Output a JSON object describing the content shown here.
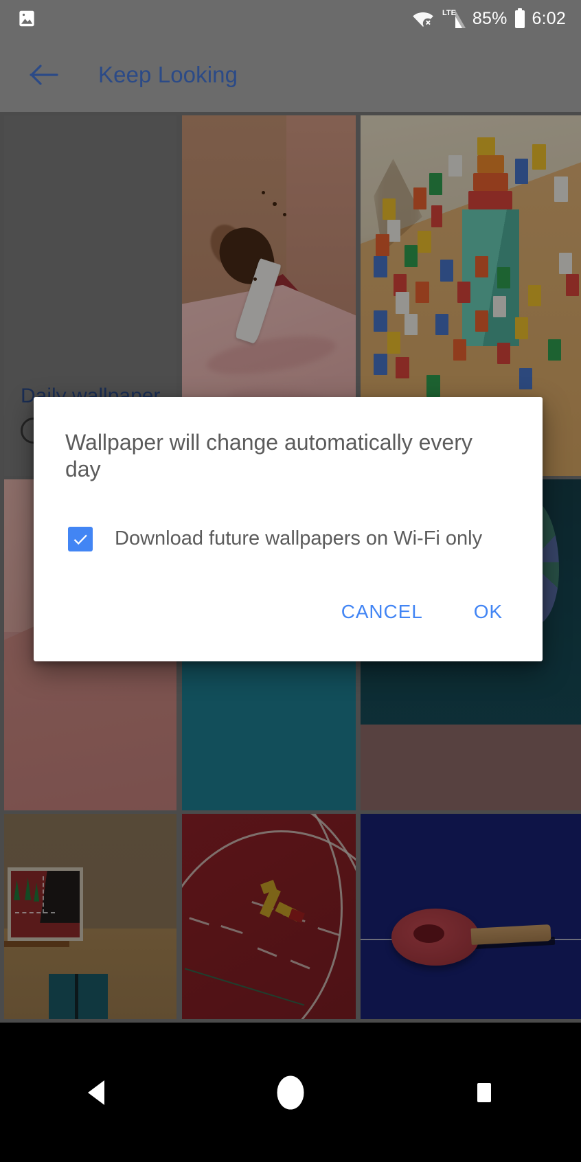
{
  "status_bar": {
    "notification_icon": "image-icon",
    "wifi_icon": "wifi-disconnected-icon",
    "network_type": "LTE",
    "signal_icon": "cellular-signal-icon",
    "battery_percent": "85%",
    "battery_icon": "battery-icon",
    "time": "6:02"
  },
  "toolbar": {
    "back_icon": "back-arrow-icon",
    "title": "Keep Looking",
    "title_color": "#2b4a87"
  },
  "background_page": {
    "section_label": "Daily wallpaper",
    "radio_option": ""
  },
  "dialog": {
    "message": "Wallpaper will change automatically every day",
    "checkbox": {
      "label": "Download future wallpapers on Wi-Fi only",
      "checked": true,
      "checked_color": "#4285f4",
      "check_icon": "checkmark-icon"
    },
    "buttons": {
      "cancel": "CANCEL",
      "ok": "OK",
      "color": "#4285f4"
    }
  },
  "nav_bar": {
    "back": "back-triangle-icon",
    "home": "home-circle-icon",
    "recents": "recents-square-icon"
  },
  "wallpaper_grid": {
    "tiles": [
      {
        "name": "placeholder-grey",
        "art": "grey"
      },
      {
        "name": "pink-bedroom-spilled-coffee",
        "art": "bed"
      },
      {
        "name": "toy-blocks-pedestal",
        "art": "blocks"
      },
      {
        "name": "pink-corridor",
        "art": "corridor"
      },
      {
        "name": "teal-room-shelf",
        "art": "teal"
      },
      {
        "name": "night-hot-air-balloon",
        "art": "night"
      },
      {
        "name": "brown-room-painting",
        "art": "brown"
      },
      {
        "name": "red-running-track",
        "art": "track"
      },
      {
        "name": "blue-ping-pong-paddle",
        "art": "pingpong"
      }
    ]
  }
}
